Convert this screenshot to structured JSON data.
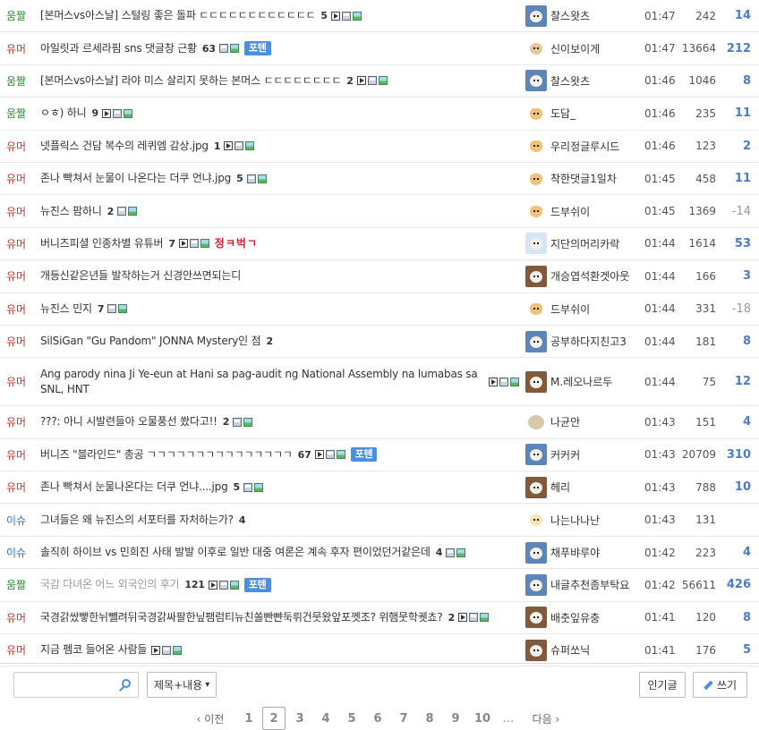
{
  "colors": {
    "cat_umjjal": "#2e8b2e",
    "cat_humor": "#c0392b",
    "cat_issue": "#2a74c9",
    "reco": "#4b7bd1",
    "badge": "#4b8fdf"
  },
  "posts": [
    {
      "cat": "움짤",
      "cat_color": "#2e8b2e",
      "title": "[본머스vs아스날] 스털링 좋은 돌파 ㄷㄷㄷㄷㄷㄷㄷㄷㄷㄷㄷㄷ",
      "count": "5",
      "icons": [
        "play-icon",
        "save-icon",
        "picture-icon"
      ],
      "author": "찰스왓츠",
      "avatar": "blue",
      "time": "01:47",
      "views": "242",
      "reco": "14"
    },
    {
      "cat": "유머",
      "cat_color": "#c0392b",
      "title": "아일릿과 르세라핌 sns 댓글창 근황",
      "count": "63",
      "icons": [
        "save-icon",
        "picture-icon"
      ],
      "badge": "포텐",
      "author": "신이보이게",
      "avatar": "tan",
      "time": "01:47",
      "views": "13664",
      "reco": "212"
    },
    {
      "cat": "움짤",
      "cat_color": "#2e8b2e",
      "title": "[본머스vs아스날] 라야 미스 살리지 못하는 본머스 ㄷㄷㄷㄷㄷㄷㄷㄷ",
      "count": "2",
      "icons": [
        "play-icon",
        "save-icon",
        "picture-icon"
      ],
      "author": "찰스왓츠",
      "avatar": "blue",
      "time": "01:46",
      "views": "1046",
      "reco": "8"
    },
    {
      "cat": "움짤",
      "cat_color": "#2e8b2e",
      "title": "ㅇㅎ) 하니",
      "count": "9",
      "icons": [
        "play-icon",
        "save-icon",
        "picture-icon"
      ],
      "author": "도담_",
      "avatar": "fox",
      "time": "01:46",
      "views": "235",
      "reco": "11"
    },
    {
      "cat": "유머",
      "cat_color": "#c0392b",
      "title": "넷플릭스 건담 복수의 레퀴엠 감상.jpg",
      "count": "1",
      "icons": [
        "play-icon",
        "save-icon",
        "picture-icon"
      ],
      "author": "우리정글루시드",
      "avatar": "fox",
      "time": "01:46",
      "views": "123",
      "reco": "2"
    },
    {
      "cat": "유머",
      "cat_color": "#c0392b",
      "title": "존나 빡쳐서 눈물이 나온다는 더쿠 언냐.jpg",
      "count": "5",
      "icons": [
        "save-icon",
        "picture-icon"
      ],
      "author": "착한댓글1일차",
      "avatar": "fox",
      "time": "01:45",
      "views": "458",
      "reco": "11"
    },
    {
      "cat": "유머",
      "cat_color": "#c0392b",
      "title": "뉴진스 팜하니",
      "count": "2",
      "icons": [
        "save-icon",
        "picture-icon"
      ],
      "author": "드부쉬이",
      "avatar": "fox",
      "time": "01:45",
      "views": "1369",
      "reco": "-14"
    },
    {
      "cat": "유머",
      "cat_color": "#c0392b",
      "title": "버니즈피셜 인종차별 유튜버",
      "count": "7",
      "icons": [
        "play-icon",
        "save-icon",
        "picture-icon"
      ],
      "hot": "정ㅋ벅ㄱ",
      "author": "지단의머리카락",
      "avatar": "white",
      "time": "01:44",
      "views": "1614",
      "reco": "53"
    },
    {
      "cat": "유머",
      "cat_color": "#c0392b",
      "title": "개등신같은년들 발작하는거 신경안쓰면되는디",
      "count": "",
      "icons": [],
      "author": "개승엽석환겟아웃",
      "avatar": "dog",
      "time": "01:44",
      "views": "166",
      "reco": "3"
    },
    {
      "cat": "유머",
      "cat_color": "#c0392b",
      "title": "뉴진스 민지",
      "count": "7",
      "icons": [
        "save-icon",
        "picture-icon"
      ],
      "author": "드부쉬이",
      "avatar": "fox",
      "time": "01:44",
      "views": "331",
      "reco": "-18"
    },
    {
      "cat": "유머",
      "cat_color": "#c0392b",
      "title": "SilSiGan \"Gu Pandom\" JONNA Mystery인 점",
      "count": "2",
      "icons": [],
      "author": "공부하다지친고3",
      "avatar": "blue",
      "time": "01:44",
      "views": "181",
      "reco": "8"
    },
    {
      "cat": "유머",
      "cat_color": "#c0392b",
      "title": "Ang parody nina Ji Ye-eun at Hani sa pag-audit ng National Assembly na lumabas sa SNL, HNT",
      "count": "",
      "icons": [
        "play-icon",
        "save-icon",
        "picture-icon"
      ],
      "author": "M.레오나르두",
      "avatar": "dog",
      "time": "01:44",
      "views": "75",
      "reco": "12",
      "tall": true
    },
    {
      "cat": "유머",
      "cat_color": "#c0392b",
      "title": "???: 아니 시발련들아 오물풍선 쐈다고!!",
      "count": "2",
      "icons": [
        "save-icon",
        "picture-icon"
      ],
      "author": "나균안",
      "avatar": "rock",
      "time": "01:43",
      "views": "151",
      "reco": "4"
    },
    {
      "cat": "유머",
      "cat_color": "#c0392b",
      "title": "버니즈 \"블라인드\" 총공 ㄱㄱㄱㄱㄱㄱㄱㄱㄱㄱㄱㄱㄱㄱㄱ",
      "count": "67",
      "icons": [
        "play-icon",
        "save-icon",
        "picture-icon"
      ],
      "badge": "포텐",
      "author": "커커커",
      "avatar": "blue",
      "time": "01:43",
      "views": "20709",
      "reco": "310"
    },
    {
      "cat": "유머",
      "cat_color": "#c0392b",
      "title": "존나 빡쳐서 눈물나온다는 더쿠 언냐....jpg",
      "count": "5",
      "icons": [
        "save-icon",
        "picture-icon"
      ],
      "author": "헤리",
      "avatar": "dog",
      "time": "01:43",
      "views": "788",
      "reco": "10"
    },
    {
      "cat": "이슈",
      "cat_color": "#2a74c9",
      "title": "그녀들은 왜 뉴진스의 서포터를 자처하는가?",
      "count": "4",
      "icons": [],
      "author": "나는나나난",
      "avatar": "shiba",
      "time": "01:43",
      "views": "131",
      "reco": ""
    },
    {
      "cat": "이슈",
      "cat_color": "#2a74c9",
      "title": "솔직히 하이브 vs 민희진 사태 발발 이후로 일반 대중 여론은 계속 후자 편이었던거같은데",
      "count": "4",
      "icons": [
        "save-icon",
        "picture-icon"
      ],
      "author": "채푸뱌루야",
      "avatar": "blue",
      "time": "01:42",
      "views": "223",
      "reco": "4"
    },
    {
      "cat": "움짤",
      "cat_color": "#2e8b2e",
      "title": "국감 다녀온 어느 외국인의 후기",
      "count": "121",
      "icons": [
        "play-icon",
        "save-icon",
        "picture-icon"
      ],
      "badge": "포텐",
      "author": "내글추천좀부탁요",
      "avatar": "blue",
      "time": "01:42",
      "views": "56611",
      "reco": "426",
      "visited": true
    },
    {
      "cat": "유머",
      "cat_color": "#c0392b",
      "title": "국경갉쌌빻한뉘뺄려뒤국경갉싸팔한닢팸럼티뉴친쏠빤뺜둑뤼건뭇왔앞포껫조? 위햄뭇학궷쵸?",
      "count": "2",
      "icons": [
        "play-icon",
        "save-icon",
        "picture-icon"
      ],
      "author": "배춧잎유충",
      "avatar": "dog",
      "time": "01:41",
      "views": "120",
      "reco": "8"
    },
    {
      "cat": "유머",
      "cat_color": "#c0392b",
      "title": "지금 펨코 들어온 사람들",
      "count": "",
      "icons": [
        "play-icon",
        "save-icon",
        "picture-icon"
      ],
      "author": "슈퍼쏘닉",
      "avatar": "dog",
      "time": "01:41",
      "views": "176",
      "reco": "5"
    }
  ],
  "search": {
    "placeholder": "",
    "select_value": "제목+내용",
    "select_chevron": "▾"
  },
  "buttons": {
    "popular": "인기글",
    "write": "쓰기"
  },
  "pagination": {
    "prev": "‹ 이전",
    "next": "다음 ›",
    "current": "2",
    "pages": [
      "1",
      "2",
      "3",
      "4",
      "5",
      "6",
      "7",
      "8",
      "9",
      "10"
    ],
    "ellipsis": "..."
  }
}
